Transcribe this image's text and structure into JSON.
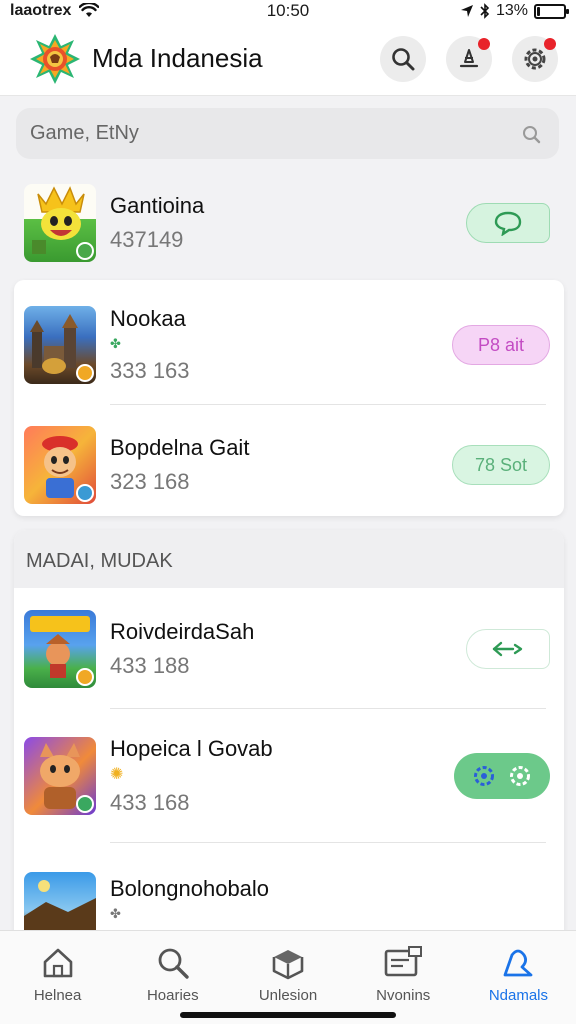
{
  "status_bar": {
    "carrier": "laaotrex",
    "time": "10:50",
    "battery": "13%",
    "battery_level": 0.13
  },
  "header": {
    "title": "Mda Indanesia",
    "search_icon": "search-icon",
    "notification_icon": "bell-icon",
    "settings_icon": "gear-icon"
  },
  "search": {
    "placeholder": "Game, EtNy"
  },
  "top_list": [
    {
      "name": "Gantioina",
      "count": "437149",
      "action_label": ""
    },
    {
      "name": "Nookaa",
      "count": "333 163",
      "action_label": "P8 ait"
    },
    {
      "name": "Bopdelna Gait",
      "count": "323 168",
      "action_label": "78 Sot"
    }
  ],
  "section": {
    "label": "MADAI, MUDAK"
  },
  "section_list": [
    {
      "name": "RoivdeirdaSah",
      "count": "433 188",
      "action_label": ""
    },
    {
      "name": "Hopeica l Govab",
      "count": "433 168",
      "action_label": ""
    },
    {
      "name": "Bolongnohobalo",
      "count": "",
      "action_label": ""
    }
  ],
  "tabs": [
    {
      "label": "Helnea",
      "icon": "home-icon"
    },
    {
      "label": "Hoaries",
      "icon": "search-icon"
    },
    {
      "label": "Unlesion",
      "icon": "box-icon"
    },
    {
      "label": "Nvonins",
      "icon": "inbox-icon"
    },
    {
      "label": "Ndamals",
      "icon": "profile-icon"
    }
  ],
  "colors": {
    "accent": "#1a73e8",
    "green_pill": "#d9f5e2",
    "pink_pill": "#f8d6f7",
    "badge_red": "#e8232a"
  }
}
